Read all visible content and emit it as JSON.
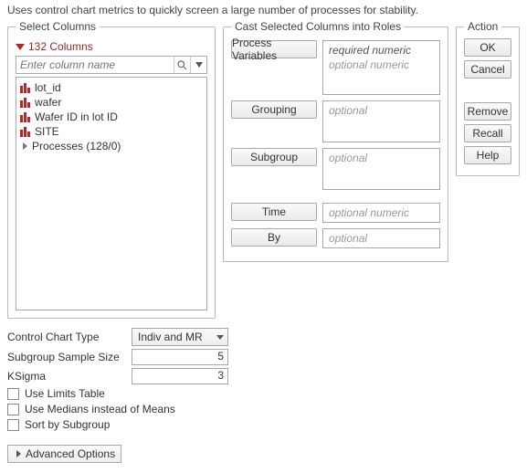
{
  "description": "Uses control chart metrics to quickly screen a large number of processes for stability.",
  "selectColumns": {
    "legend": "Select Columns",
    "countLabel": "132 Columns",
    "filterPlaceholder": "Enter column name",
    "items": {
      "lot_id": "lot_id",
      "wafer": "wafer",
      "waferIdInLot": "Wafer ID in lot ID",
      "site": "SITE",
      "processes": "Processes (128/0)"
    }
  },
  "castRoles": {
    "legend": "Cast Selected Columns into Roles",
    "roles": {
      "processVariables": {
        "label": "Process Variables",
        "req": "required numeric",
        "opt": "optional numeric"
      },
      "grouping": {
        "label": "Grouping",
        "opt": "optional"
      },
      "subgroup": {
        "label": "Subgroup",
        "opt": "optional"
      },
      "time": {
        "label": "Time",
        "opt": "optional numeric"
      },
      "by": {
        "label": "By",
        "opt": "optional"
      }
    }
  },
  "action": {
    "legend": "Action",
    "ok": "OK",
    "cancel": "Cancel",
    "remove": "Remove",
    "recall": "Recall",
    "help": "Help"
  },
  "controls": {
    "chartTypeLabel": "Control Chart Type",
    "chartTypeValue": "Indiv and MR",
    "subgroupSizeLabel": "Subgroup Sample Size",
    "subgroupSizeValue": "5",
    "ksigmaLabel": "KSigma",
    "ksigmaValue": "3",
    "useLimitsTable": "Use Limits Table",
    "useMedians": "Use Medians instead of Means",
    "sortBySubgroup": "Sort by Subgroup"
  },
  "advanced": "Advanced Options"
}
